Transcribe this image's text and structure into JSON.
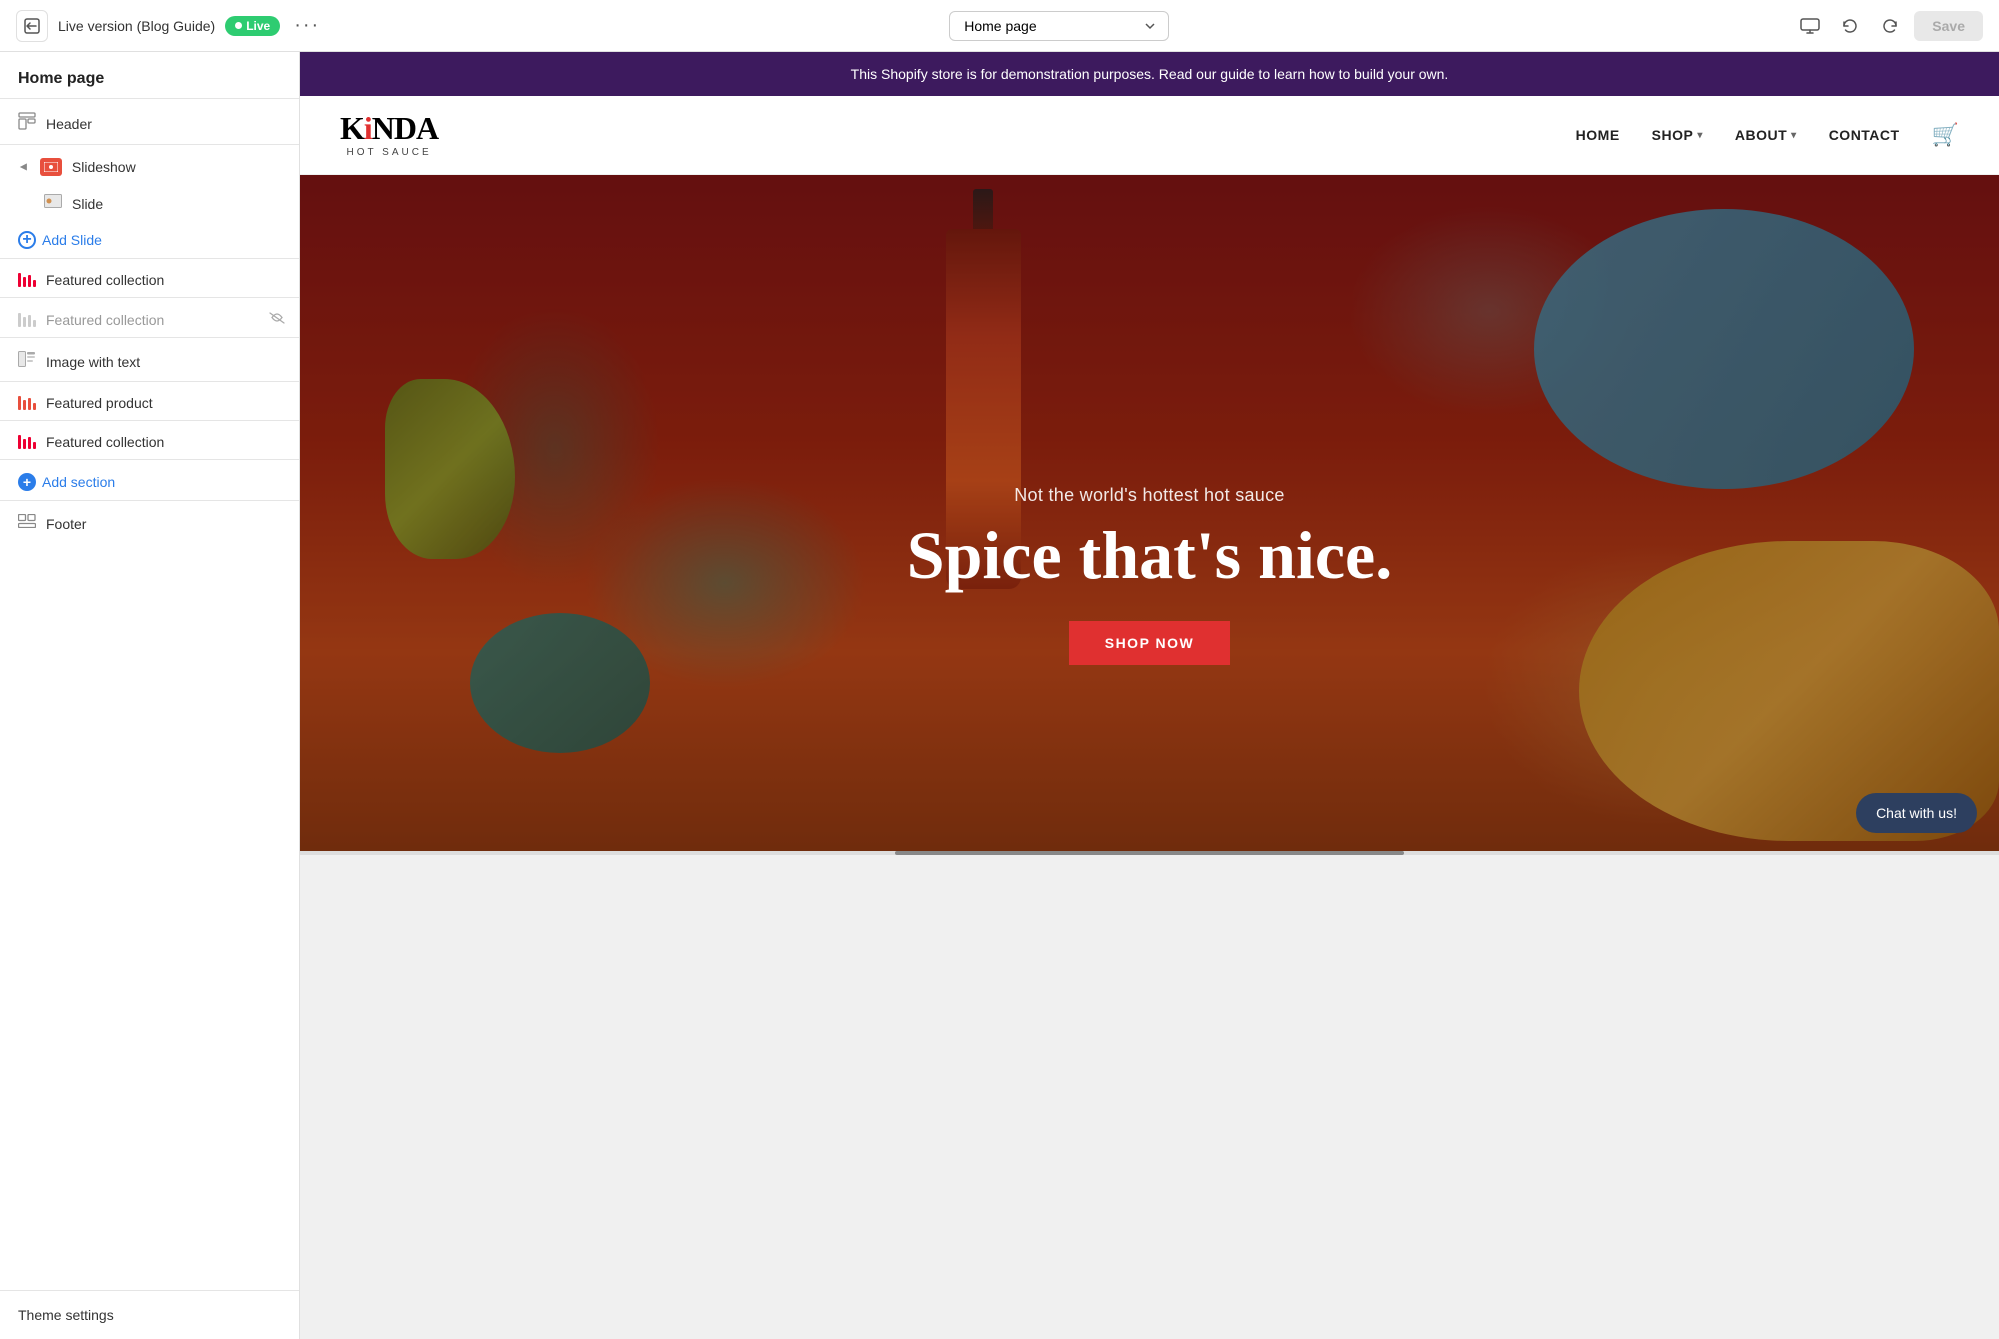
{
  "topbar": {
    "title": "Live version (Blog Guide)",
    "live_label": "Live",
    "more_btn": "···",
    "page_selector": "Home page",
    "save_btn": "Save"
  },
  "sidebar": {
    "page_title": "Home page",
    "items": [
      {
        "id": "header",
        "label": "Header",
        "type": "header",
        "depth": 0
      },
      {
        "id": "slideshow",
        "label": "Slideshow",
        "type": "slideshow",
        "depth": 0,
        "expanded": true
      },
      {
        "id": "slide",
        "label": "Slide",
        "type": "slide",
        "depth": 1
      },
      {
        "id": "add-slide",
        "label": "Add Slide",
        "type": "add",
        "depth": 1
      },
      {
        "id": "featured-collection-1",
        "label": "Featured collection",
        "type": "collection",
        "depth": 0
      },
      {
        "id": "featured-collection-2",
        "label": "Featured collection",
        "type": "collection",
        "depth": 0,
        "muted": true,
        "hidden": true
      },
      {
        "id": "image-with-text",
        "label": "Image with text",
        "type": "image-text",
        "depth": 0
      },
      {
        "id": "featured-product",
        "label": "Featured product",
        "type": "product",
        "depth": 0
      },
      {
        "id": "featured-collection-3",
        "label": "Featured collection",
        "type": "collection",
        "depth": 0
      },
      {
        "id": "add-section",
        "label": "Add section",
        "type": "add-section",
        "depth": 0
      },
      {
        "id": "footer",
        "label": "Footer",
        "type": "footer",
        "depth": 0
      }
    ],
    "theme_settings": "Theme settings"
  },
  "store": {
    "banner": "This Shopify store is for demonstration purposes. Read our guide to learn how to build your own.",
    "logo_main": "KiNDA",
    "logo_sub": "HOT SAUCE",
    "nav_links": [
      {
        "label": "HOME",
        "has_dropdown": false
      },
      {
        "label": "SHOP",
        "has_dropdown": true
      },
      {
        "label": "ABOUT",
        "has_dropdown": true
      },
      {
        "label": "CONTACT",
        "has_dropdown": false
      }
    ],
    "hero": {
      "subtitle": "Not the world's hottest hot sauce",
      "title": "Spice that's nice.",
      "cta_btn": "SHOP NOW"
    },
    "chat_widget": "Chat with us!"
  }
}
